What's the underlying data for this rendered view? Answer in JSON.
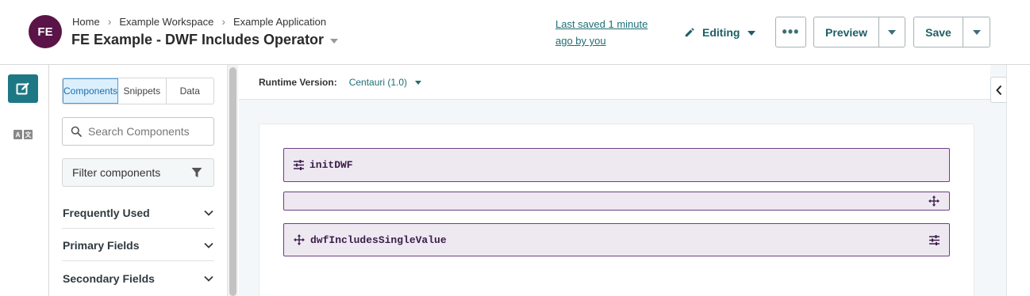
{
  "header": {
    "avatar_initials": "FE",
    "breadcrumbs": [
      "Home",
      "Example Workspace",
      "Example Application"
    ],
    "title": "FE Example - DWF Includes Operator",
    "last_saved": "Last saved 1 minute ago by you",
    "mode": "Editing",
    "more_label": "•••",
    "preview_label": "Preview",
    "save_label": "Save"
  },
  "rail": {
    "items": [
      {
        "icon": "edit-icon",
        "active": true
      },
      {
        "icon": "translate-icon",
        "active": false
      }
    ],
    "translate_glyphs": [
      "A",
      "文"
    ]
  },
  "panel": {
    "tabs": [
      {
        "label": "Components",
        "active": true
      },
      {
        "label": "Snippets",
        "active": false
      },
      {
        "label": "Data",
        "active": false
      }
    ],
    "search": {
      "placeholder": "Search Components",
      "value": ""
    },
    "filter_label": "Filter components",
    "sections": [
      {
        "label": "Frequently Used"
      },
      {
        "label": "Primary Fields"
      },
      {
        "label": "Secondary Fields"
      }
    ]
  },
  "canvas": {
    "runtime_label": "Runtime Version:",
    "runtime_value": "Centauri (1.0)",
    "components": [
      {
        "name": "initDWF",
        "icon": "sliders-icon"
      },
      {
        "name": "",
        "icon": "move-icon"
      },
      {
        "name": "dwfIncludesSingleValue",
        "icon": "move-icon",
        "trailing_icon": "sliders-icon"
      }
    ]
  },
  "colors": {
    "brand": "#5a1447",
    "accent": "#1e7784",
    "component_border": "#6e3f86",
    "component_bg": "#eee8f1"
  }
}
